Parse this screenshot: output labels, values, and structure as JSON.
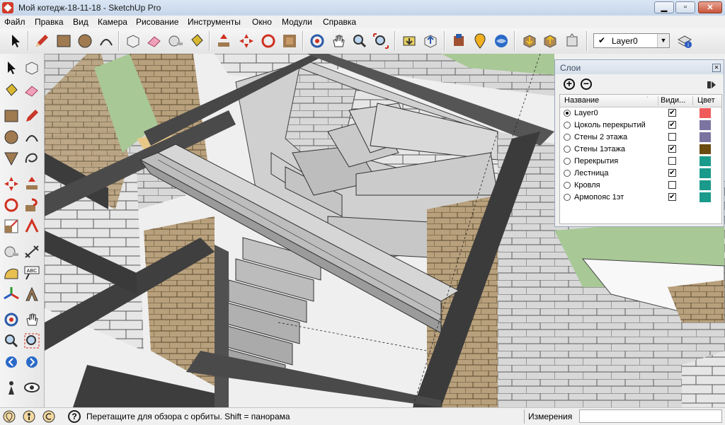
{
  "window": {
    "title": "Мой котедж-18-11-18 - SketchUp Pro"
  },
  "menu": [
    "Файл",
    "Правка",
    "Вид",
    "Камера",
    "Рисование",
    "Инструменты",
    "Окно",
    "Модули",
    "Справка"
  ],
  "layer_selector": {
    "check": "✔",
    "value": "Layer0",
    "arrow": "▼"
  },
  "layers_panel": {
    "title": "Слои",
    "columns": {
      "name": "Название",
      "visible": "Види...",
      "color": "Цвет"
    },
    "layers": [
      {
        "name": "Layer0",
        "selected": true,
        "visible": true,
        "color": "#f05a5a"
      },
      {
        "name": "Цоколь перекрытий",
        "selected": false,
        "visible": true,
        "color": "#7b74a0"
      },
      {
        "name": "Стены 2 этажа",
        "selected": false,
        "visible": false,
        "color": "#7b74a0"
      },
      {
        "name": "Стены 1этажа",
        "selected": false,
        "visible": true,
        "color": "#6b4a10"
      },
      {
        "name": "Перекрытия",
        "selected": false,
        "visible": false,
        "color": "#1a9a8a"
      },
      {
        "name": "Лестница",
        "selected": false,
        "visible": true,
        "color": "#1a9a8a"
      },
      {
        "name": "Кровля",
        "selected": false,
        "visible": false,
        "color": "#1a9a8a"
      },
      {
        "name": "Армопояс 1эт",
        "selected": false,
        "visible": true,
        "color": "#1a9a8a"
      }
    ]
  },
  "status": {
    "hint": "Перетащите для обзора с орбиты.  Shift = панорама",
    "measure_label": "Измерения",
    "measure_value": ""
  }
}
